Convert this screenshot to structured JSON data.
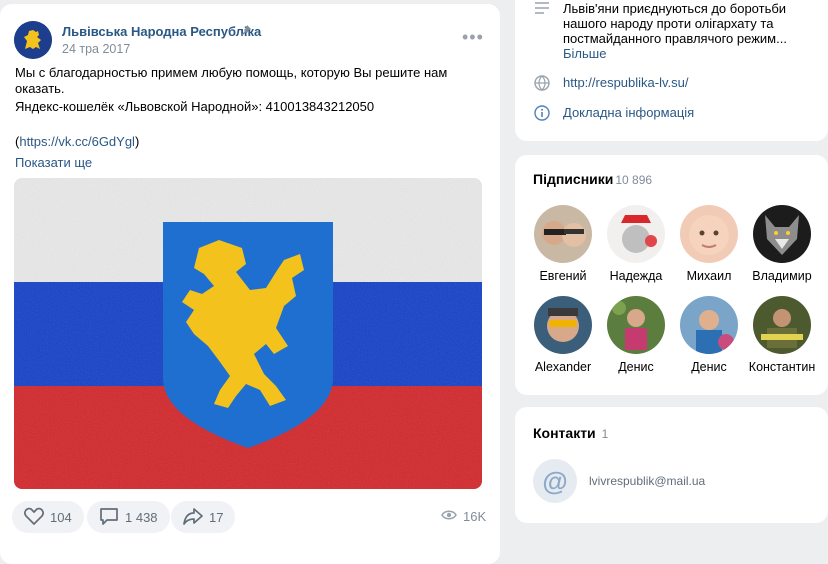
{
  "post": {
    "group_name": "Львівська Народна Республіка",
    "date": "24 тра 2017",
    "line1": "Мы с благодарностью примем любую помощь, которую Вы решите нам оказать.",
    "line2": "Яндекс-кошелёк «Львовской Народной»: 410013843212050",
    "link_open": "(",
    "link": "https://vk.cc/6GdYgl",
    "link_close": ")",
    "show_more": "Показати ще",
    "likes": "104",
    "comments": "1 438",
    "shares": "17",
    "views": "16K",
    "icons": [
      "pin-icon",
      "more-icon",
      "heart-icon",
      "comment-icon",
      "share-icon",
      "eye-icon"
    ]
  },
  "info": {
    "description": "Львів'яни приєднуються до боротьби нашого народу проти олігархату та постмайданного правлячого режим...",
    "more": "Більше",
    "website": "http://respublika-lv.su/",
    "details": "Докладна інформація"
  },
  "subscribers": {
    "title": "Підписники",
    "count": "10 896",
    "items": [
      {
        "name": "Евгений"
      },
      {
        "name": "Надежда"
      },
      {
        "name": "Михаил"
      },
      {
        "name": "Владимир"
      },
      {
        "name": "Alexander"
      },
      {
        "name": "Денис"
      },
      {
        "name": "Денис"
      },
      {
        "name": "Константин"
      }
    ]
  },
  "contacts": {
    "title": "Контакти",
    "count": "1",
    "email": "lvivrespublik@mail.ua"
  },
  "colors": {
    "link": "#2a5885",
    "flag_white": "#e9e9e9",
    "flag_blue": "#1440c8",
    "flag_red": "#d2262a",
    "shield_blue": "#1f6fd1",
    "lion_yellow": "#f3c21d"
  }
}
